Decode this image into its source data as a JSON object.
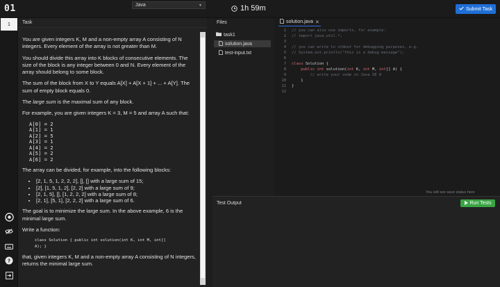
{
  "header": {
    "logo": "01",
    "timer": "1h 59m",
    "submit_label": "Submit Task"
  },
  "rail": {
    "task_number": "1",
    "icons": [
      "gear-icon",
      "eye-off-icon",
      "keyboard-icon",
      "help-icon",
      "logout-icon"
    ]
  },
  "task": {
    "title": "Task",
    "language": "Java",
    "paragraphs": {
      "p1": "You are given integers K, M and a non-empty array A consisting of N integers. Every element of the array is not greater than M.",
      "p2": "You should divide this array into K blocks of consecutive elements. The size of the block is any integer between 0 and N. Every element of the array should belong to some block.",
      "p3": "The sum of the block from X to Y equals A[X] + A[X + 1] + ... + A[Y]. The sum of empty block equals 0.",
      "p4_em": "large sum",
      "p4_pre": "The ",
      "p4_post": " is the maximal sum of any block.",
      "p5": "For example, you are given integers K = 3, M = 5 and array A such that:",
      "array_lines": [
        "A[0] = 2",
        "A[1] = 1",
        "A[2] = 5",
        "A[3] = 1",
        "A[4] = 2",
        "A[5] = 2",
        "A[6] = 2"
      ],
      "p6": "The array can be divided, for example, into the following blocks:",
      "blocks": [
        "[2, 1, 5, 1, 2, 2, 2], [], [] with a large sum of 15;",
        "[2], [1, 5, 1, 2], [2, 2] with a large sum of 9;",
        "[2, 1, 5], [], [1, 2, 2, 2] with a large sum of 8;",
        "[2, 1], [5, 1], [2, 2, 2] with a large sum of 6."
      ],
      "p7": "The goal is to minimize the large sum. In the above example, 6 is the minimal large sum.",
      "p8": "Write a function:",
      "signature": "class Solution { public int solution(int K, int M, int[]\nA); }",
      "p9": "that, given integers K, M and a non-empty array A consisting of N integers, returns the minimal large sum."
    }
  },
  "files": {
    "title": "Files",
    "folder": "task1",
    "items": [
      "solution.java",
      "test-input.txt"
    ]
  },
  "editor": {
    "tab_label": "solution.java",
    "line_numbers": [
      "1",
      "2",
      "3",
      "4",
      "5",
      "6",
      "7",
      "8",
      "9",
      "10",
      "11",
      "12"
    ],
    "lines": {
      "l1": "// you can also use imports, for example:",
      "l2": "// import java.util.*;",
      "l4": "// you can write to stdout for debugging purposes, e.g.",
      "l5": "// System.out.println(\"this is a debug message\");",
      "l7_kw": "class",
      "l7_rest": " Solution {",
      "l8_kw1": "    public int",
      "l8_rest1": " solution(",
      "l8_kw2": "int",
      "l8_rest2": " K, ",
      "l8_kw3": "int",
      "l8_rest3": " M, ",
      "l8_kw4": "int",
      "l8_rest4": "[] A) {",
      "l9": "        // write your code in Java SE 8",
      "l10": "    }",
      "l11": "}"
    },
    "status_note": "You will see save status here"
  },
  "output": {
    "title": "Test Output",
    "run_label": "Run Tests"
  }
}
